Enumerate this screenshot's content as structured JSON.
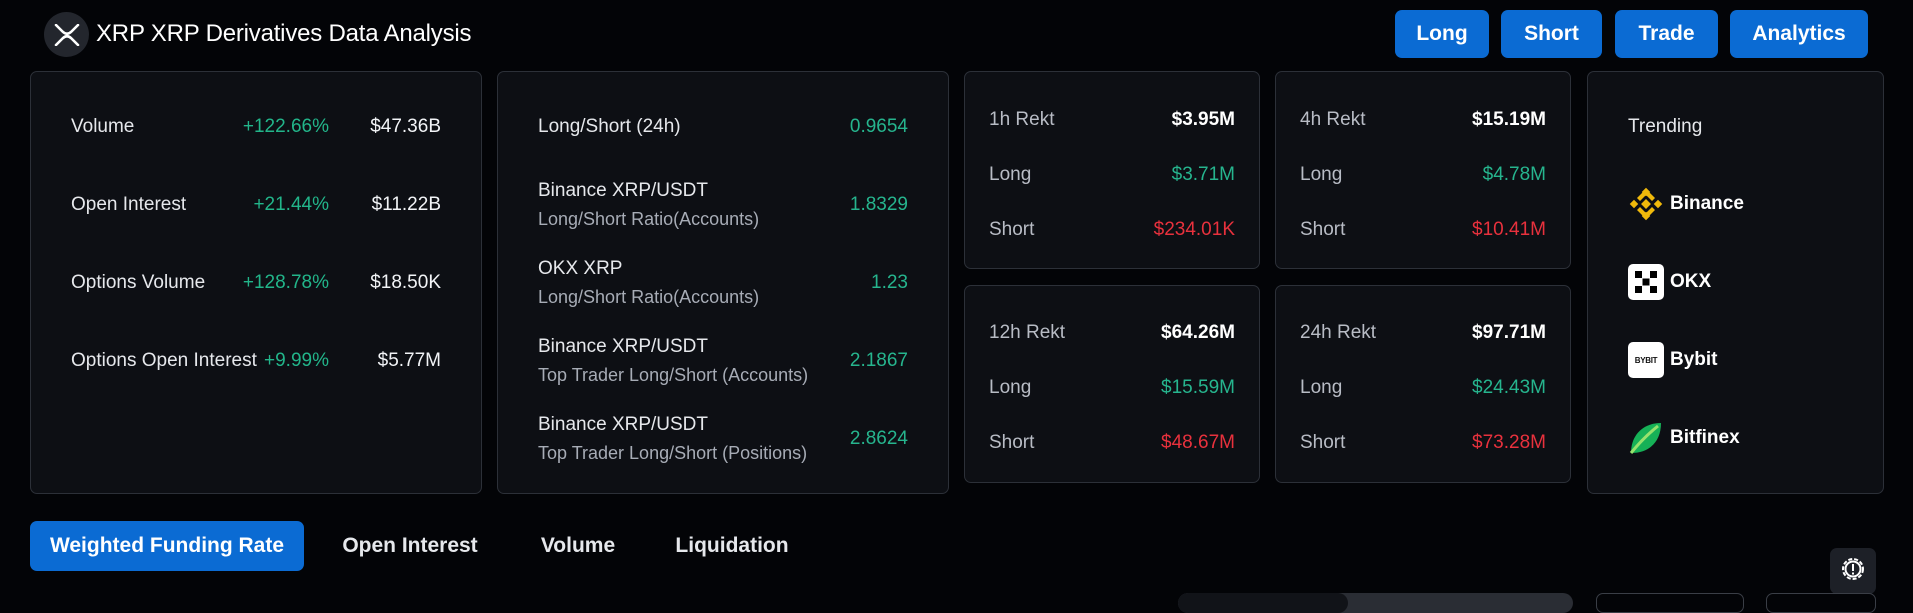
{
  "header": {
    "logo_icon": "xrp-logo-icon",
    "title": "XRP XRP Derivatives Data Analysis",
    "nav": [
      "Long",
      "Short",
      "Trade",
      "Analytics"
    ]
  },
  "market": {
    "rows": [
      {
        "label": "Volume",
        "change": "+122.66%",
        "value": "$47.36B"
      },
      {
        "label": "Open Interest",
        "change": "+21.44%",
        "value": "$11.22B"
      },
      {
        "label": "Options Volume",
        "change": "+128.78%",
        "value": "$18.50K"
      },
      {
        "label": "Options Open Interest",
        "change": "+9.99%",
        "value": "$5.77M"
      }
    ]
  },
  "ratios": {
    "rows": [
      {
        "label": "Long/Short (24h)",
        "sub": "",
        "value": "0.9654"
      },
      {
        "label": "Binance XRP/USDT",
        "sub": "Long/Short Ratio(Accounts)",
        "value": "1.8329"
      },
      {
        "label": "OKX XRP",
        "sub": "Long/Short Ratio(Accounts)",
        "value": "1.23"
      },
      {
        "label": "Binance XRP/USDT",
        "sub": "Top Trader Long/Short (Accounts)",
        "value": "2.1867"
      },
      {
        "label": "Binance XRP/USDT",
        "sub": "Top Trader Long/Short (Positions)",
        "value": "2.8624"
      }
    ]
  },
  "rekt": [
    {
      "title": "1h Rekt",
      "total": "$3.95M",
      "long_label": "Long",
      "long": "$3.71M",
      "short_label": "Short",
      "short": "$234.01K"
    },
    {
      "title": "4h Rekt",
      "total": "$15.19M",
      "long_label": "Long",
      "long": "$4.78M",
      "short_label": "Short",
      "short": "$10.41M"
    },
    {
      "title": "12h Rekt",
      "total": "$64.26M",
      "long_label": "Long",
      "long": "$15.59M",
      "short_label": "Short",
      "short": "$48.67M"
    },
    {
      "title": "24h Rekt",
      "total": "$97.71M",
      "long_label": "Long",
      "long": "$24.43M",
      "short_label": "Short",
      "short": "$73.28M"
    }
  ],
  "trending": {
    "title": "Trending",
    "items": [
      {
        "name": "Binance",
        "icon": "binance-icon"
      },
      {
        "name": "OKX",
        "icon": "okx-icon"
      },
      {
        "name": "Bybit",
        "icon": "bybit-icon",
        "logo_text": "BYBIT"
      },
      {
        "name": "Bitfinex",
        "icon": "bitfinex-icon"
      }
    ]
  },
  "tabs": [
    "Weighted Funding Rate",
    "Open Interest",
    "Volume",
    "Liquidation"
  ],
  "settings_icon": "settings-icon",
  "colors": {
    "accent": "#0b6bd3",
    "positive": "#26b58e",
    "negative": "#e8313d",
    "card": "#0d0f14",
    "background": "#030407"
  }
}
